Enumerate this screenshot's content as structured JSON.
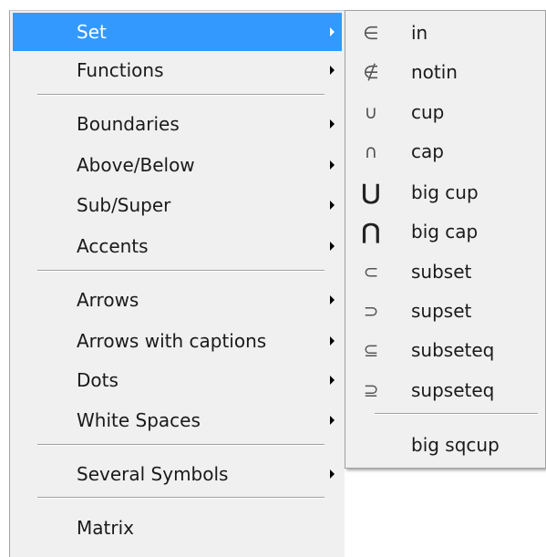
{
  "main_menu": {
    "items": [
      {
        "label": "Set",
        "submenu": true,
        "selected": true
      },
      {
        "label": "Functions",
        "submenu": true
      },
      {
        "label": "Boundaries",
        "submenu": true
      },
      {
        "label": "Above/Below",
        "submenu": true
      },
      {
        "label": "Sub/Super",
        "submenu": true
      },
      {
        "label": "Accents",
        "submenu": true
      },
      {
        "label": "Arrows",
        "submenu": true
      },
      {
        "label": "Arrows with captions",
        "submenu": true
      },
      {
        "label": "Dots",
        "submenu": true
      },
      {
        "label": "White Spaces",
        "submenu": true
      },
      {
        "label": "Several Symbols",
        "submenu": true
      },
      {
        "label": "Matrix",
        "submenu": false
      }
    ]
  },
  "set_submenu": {
    "items": [
      {
        "symbol": "∈",
        "label": "in"
      },
      {
        "symbol": "∉",
        "label": "notin"
      },
      {
        "symbol": "∪",
        "label": "cup"
      },
      {
        "symbol": "∩",
        "label": "cap"
      },
      {
        "symbol": "⋃",
        "label": "big cup"
      },
      {
        "symbol": "⋂",
        "label": "big cap"
      },
      {
        "symbol": "⊂",
        "label": "subset"
      },
      {
        "symbol": "⊃",
        "label": "supset"
      },
      {
        "symbol": "⊆",
        "label": "subseteq"
      },
      {
        "symbol": "⊇",
        "label": "supseteq"
      },
      {
        "symbol": "",
        "label": "big sqcup"
      }
    ]
  },
  "colors": {
    "highlight": "#3399ff",
    "menu_bg": "#f0f0f0",
    "separator": "#a0a0a0"
  }
}
